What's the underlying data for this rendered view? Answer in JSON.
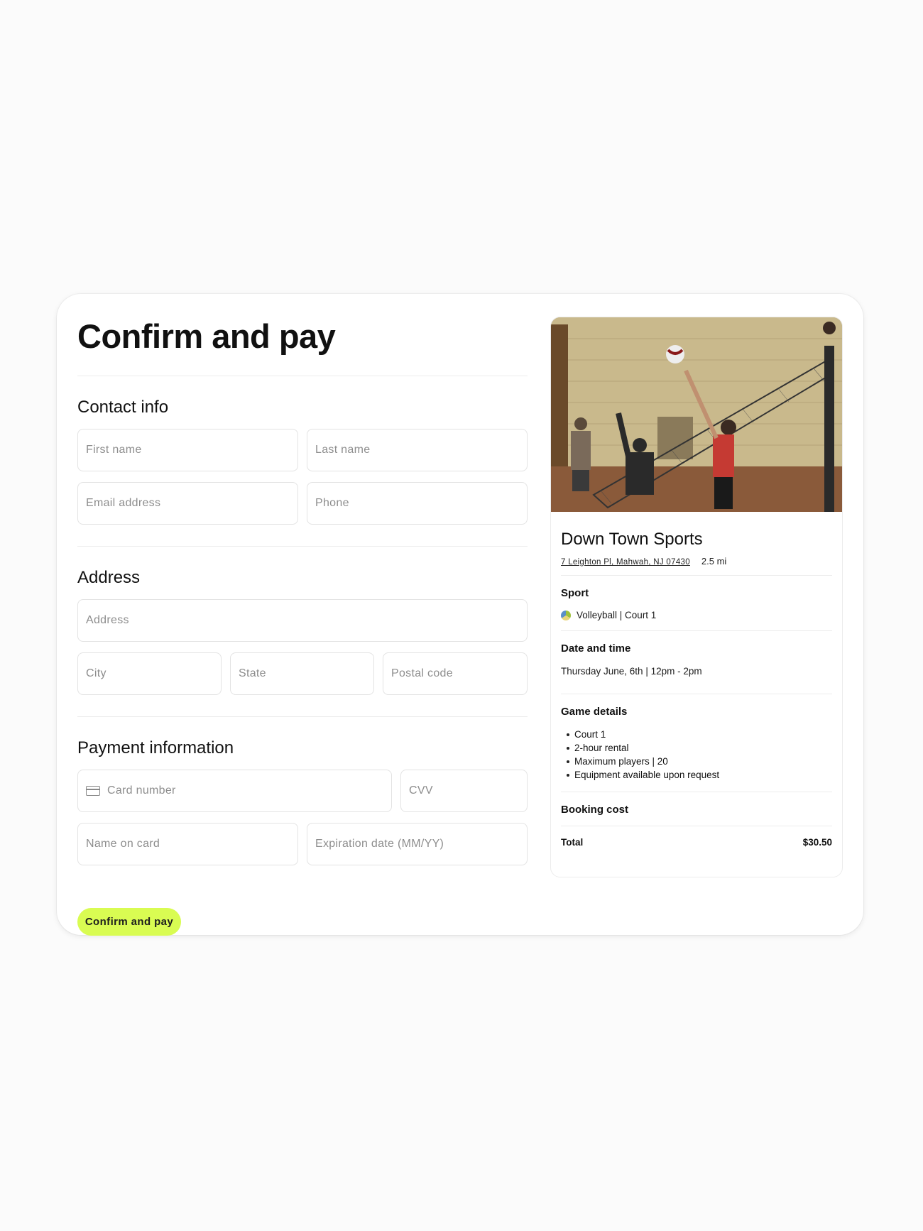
{
  "page": {
    "title": "Confirm and pay"
  },
  "contact": {
    "title": "Contact info",
    "first_name": "First name",
    "last_name": "Last name",
    "email": "Email address",
    "phone": "Phone"
  },
  "address": {
    "title": "Address",
    "address": "Address",
    "city": "City",
    "state": "State",
    "postal": "Postal code"
  },
  "payment": {
    "title": "Payment information",
    "card_number": "Card number",
    "card_icon": "credit-card-icon",
    "cvv": "CVV",
    "name_on_card": "Name on card",
    "expiration": "Expiration date (MM/YY)"
  },
  "actions": {
    "confirm_label": "Confirm and pay",
    "accent": "#d9fc52"
  },
  "venue": {
    "name": "Down Town Sports",
    "address": "7 Leighton Pl, Mahwah, NJ 07430",
    "distance": "2.5 mi",
    "sport_heading": "Sport",
    "sport_icon": "volleyball-icon",
    "sport_value": "Volleyball | Court 1",
    "date_heading": "Date and time",
    "date_value": "Thursday June, 6th | 12pm - 2pm",
    "details_heading": "Game details",
    "details": [
      "Court 1",
      "2-hour rental",
      "Maximum players | 20",
      "Equipment available upon request"
    ],
    "cost_heading": "Booking cost",
    "total_label": "Total",
    "total_value": "$30.50"
  }
}
